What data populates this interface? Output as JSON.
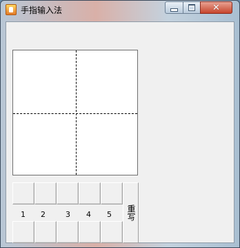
{
  "window": {
    "title": "手指输入法"
  },
  "candidates": {
    "numbers": [
      "1",
      "2",
      "3",
      "4",
      "5"
    ]
  },
  "rewrite_label": "重写"
}
